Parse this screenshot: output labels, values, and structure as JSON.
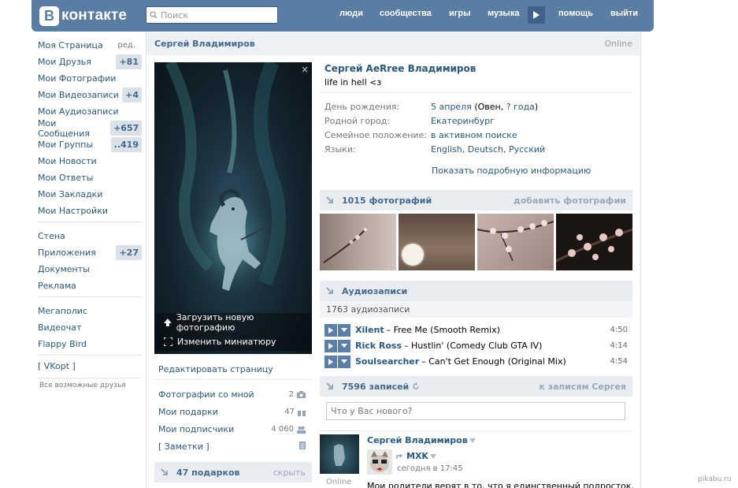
{
  "header": {
    "logo_mark": "В",
    "logo_text": "контакте",
    "search_placeholder": "Поиск",
    "nav": [
      "люди",
      "сообщества",
      "игры",
      "музыка",
      "помощь",
      "выйти"
    ]
  },
  "sidebar": {
    "items": [
      {
        "label": "Моя Страница",
        "extra": "ред."
      },
      {
        "label": "Мои Друзья",
        "badge": "+81"
      },
      {
        "label": "Мои Фотографии"
      },
      {
        "label": "Мои Видеозаписи",
        "badge": "+4"
      },
      {
        "label": "Мои Аудиозаписи"
      },
      {
        "label": "Мои Сообщения",
        "badge": "+657"
      },
      {
        "label": "Мои Группы",
        "badge": "..419"
      },
      {
        "label": "Мои Новости"
      },
      {
        "label": "Мои Ответы"
      },
      {
        "label": "Мои Закладки"
      },
      {
        "label": "Мои Настройки"
      }
    ],
    "items2": [
      {
        "label": "Стена"
      },
      {
        "label": "Приложения",
        "badge": "+27"
      },
      {
        "label": "Документы"
      },
      {
        "label": "Реклама"
      }
    ],
    "items3": [
      {
        "label": "Мегаполис"
      },
      {
        "label": "Видеочат"
      },
      {
        "label": "Flappy Bird"
      }
    ],
    "vkopt": "[ VKopt ]",
    "friends_note": "Все возможные друзья"
  },
  "profile_header": {
    "name": "Сергей Владимиров",
    "status": "Online"
  },
  "avatar": {
    "upload_label": "Загрузить новую фотографию",
    "thumb_label": "Изменить миниатюру",
    "close": "×"
  },
  "left_links": {
    "edit": "Редактировать страницу",
    "photos_with_me": "Фотографии со мной",
    "photos_count": "2",
    "gifts": "Мои подарки",
    "gifts_count": "47",
    "subscribers": "Мои подписчики",
    "subscribers_count": "4 060",
    "notes": "[ Заметки ]",
    "gifts_bar_title": "47 подарков",
    "gifts_bar_link": "скрыть"
  },
  "profile": {
    "full_name": "Сергей AeRree Владимиров",
    "status_text": "life in hell <з",
    "info": [
      {
        "key": "День рождения:",
        "value": "5 апреля",
        "value_plain": " (Овен, ",
        "value2": "? года",
        "value_end": ")"
      },
      {
        "key": "Родной город:",
        "value": "Екатеринбург"
      },
      {
        "key": "Семейное положение:",
        "value": "в активном поиске"
      },
      {
        "key": "Языки:",
        "value": "English, Deutsch, Русский"
      }
    ],
    "more_info": "Показать подробную информацию"
  },
  "photos": {
    "title": "1015 фотографий",
    "add_link": "добавить фотографии"
  },
  "audio": {
    "title": "Аудиозаписи",
    "count": "1763 аудиозаписи",
    "tracks": [
      {
        "artist": "Xilent",
        "title": "– Free Me (Smooth Remix)",
        "duration": "4:50"
      },
      {
        "artist": "Rick Ross",
        "title": "– Hustlin' (Comedy Club GTA IV)",
        "duration": "4:14"
      },
      {
        "artist": "Soulsearcher",
        "title": "– Can't Get Enough (Original Mix)",
        "duration": "4:54"
      }
    ]
  },
  "wall": {
    "title": "7596 записей",
    "link": "к записям Сергея",
    "placeholder": "Что у Вас нового?",
    "post_author": "Сергей Владимиров",
    "repost_from": "MXK",
    "post_time": "сегодня в 17:45",
    "post_online": "Online",
    "post_text": "Мои родители верят в то, что я единственный подросток,"
  },
  "watermark": "pikabu.ru",
  "colors": {
    "header": "#597da3",
    "link": "#2b587a",
    "badge_bg": "#dae1e8"
  }
}
